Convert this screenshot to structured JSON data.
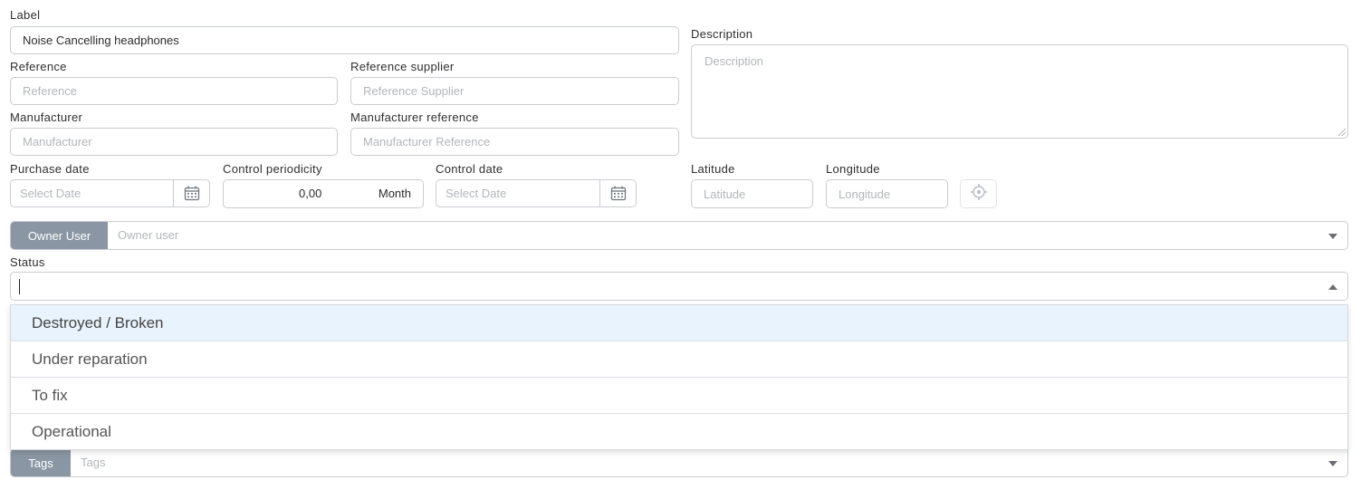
{
  "form": {
    "label": {
      "title": "Label",
      "value": "Noise Cancelling headphones"
    },
    "description": {
      "title": "Description",
      "placeholder": "Description"
    },
    "reference": {
      "title": "Reference",
      "placeholder": "Reference"
    },
    "reference_supplier": {
      "title": "Reference supplier",
      "placeholder": "Reference Supplier"
    },
    "manufacturer": {
      "title": "Manufacturer",
      "placeholder": "Manufacturer"
    },
    "manufacturer_reference": {
      "title": "Manufacturer reference",
      "placeholder": "Manufacturer Reference"
    },
    "purchase_date": {
      "title": "Purchase date",
      "placeholder": "Select Date",
      "icon": "calendar-icon"
    },
    "control_periodicity": {
      "title": "Control periodicity",
      "value": "0,00",
      "unit": "Month"
    },
    "control_date": {
      "title": "Control date",
      "placeholder": "Select Date",
      "icon": "calendar-icon"
    },
    "latitude": {
      "title": "Latitude",
      "placeholder": "Latitude"
    },
    "longitude": {
      "title": "Longitude",
      "placeholder": "Longitude"
    },
    "locate_icon": "crosshair-icon",
    "owner_user": {
      "addon": "Owner User",
      "placeholder": "Owner user"
    },
    "status": {
      "title": "Status",
      "options": [
        "Destroyed / Broken",
        "Under reparation",
        "To fix",
        "Operational"
      ],
      "highlighted": "Destroyed / Broken"
    },
    "tags": {
      "addon": "Tags",
      "placeholder": "Tags"
    }
  },
  "colors": {
    "addon_bg": "#8a96a3",
    "highlight_bg": "#e9f3fd",
    "border": "#c9ccd1"
  }
}
